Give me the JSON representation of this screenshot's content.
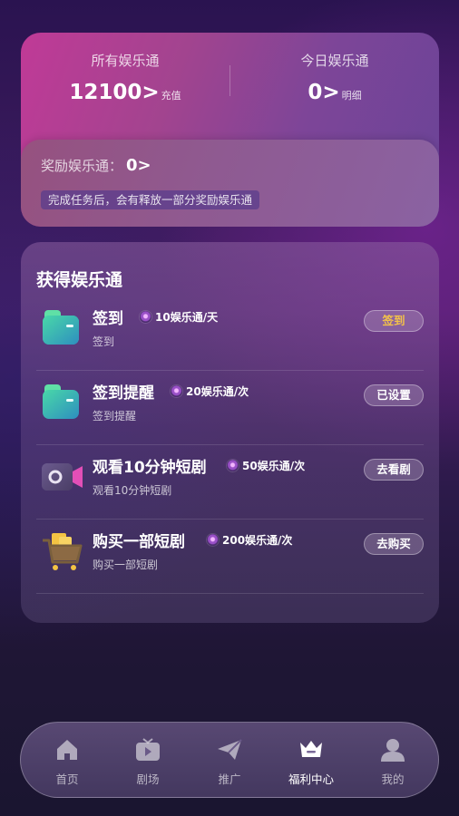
{
  "balance": {
    "total_label": "所有娱乐通",
    "total_value": "12100>",
    "total_link": "充值",
    "today_label": "今日娱乐通",
    "today_value": "0>",
    "today_link": "明细"
  },
  "reward": {
    "label": "奖励娱乐通：",
    "value": "0>",
    "note": "完成任务后，会有释放一部分奖励娱乐通"
  },
  "tasks": {
    "title": "获得娱乐通",
    "items": [
      {
        "name": "签到",
        "reward": "10娱乐通/天",
        "subtitle": "签到",
        "button": "签到",
        "icon": "wallet-icon"
      },
      {
        "name": "签到提醒",
        "reward": "20娱乐通/次",
        "subtitle": "签到提醒",
        "button": "已设置",
        "icon": "wallet-icon"
      },
      {
        "name": "观看10分钟短剧",
        "reward": "50娱乐通/次",
        "subtitle": "观看10分钟短剧",
        "button": "去看剧",
        "icon": "video-camera-icon"
      },
      {
        "name": "购买一部短剧",
        "reward": "200娱乐通/次",
        "subtitle": "购买一部短剧",
        "button": "去购买",
        "icon": "shopping-cart-icon"
      }
    ]
  },
  "nav": {
    "items": [
      {
        "label": "首页",
        "icon": "home-icon"
      },
      {
        "label": "剧场",
        "icon": "tv-play-icon"
      },
      {
        "label": "推广",
        "icon": "paper-plane-icon"
      },
      {
        "label": "福利中心",
        "icon": "crown-icon",
        "active": true
      },
      {
        "label": "我的",
        "icon": "user-icon"
      }
    ]
  },
  "colors": {
    "accent_gold": "#f2c14a",
    "card_pink": "#c03a97",
    "card_purple": "#6a4497"
  }
}
